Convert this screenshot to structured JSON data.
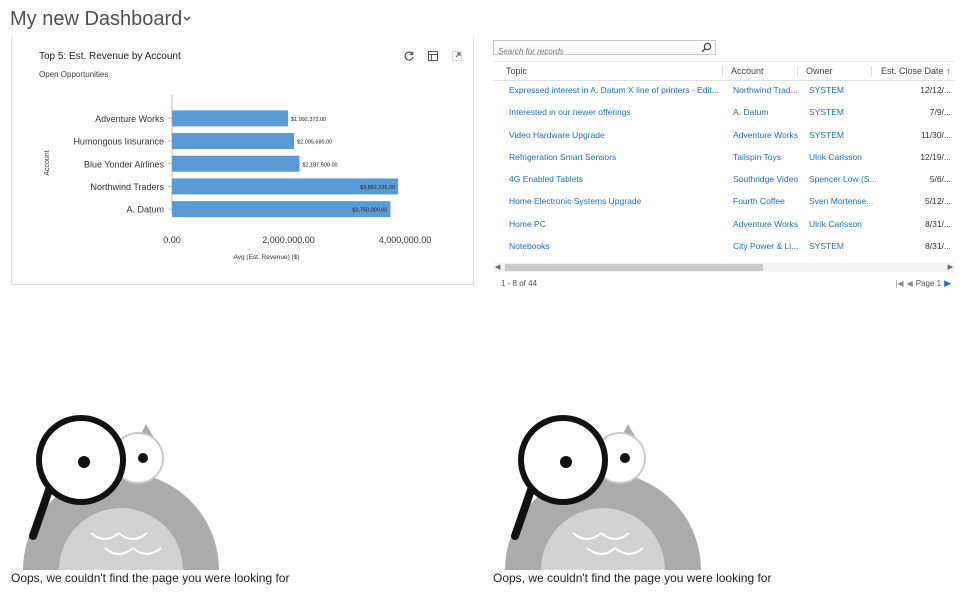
{
  "header": {
    "title": "My new Dashboard"
  },
  "chart_card": {
    "title": "Top 5: Est. Revenue by Account",
    "subtitle": "Open Opportunities",
    "tools": [
      "refresh-icon",
      "view-records-icon",
      "expand-icon"
    ]
  },
  "chart_data": {
    "type": "bar",
    "orientation": "horizontal",
    "categories": [
      "Adventure Works",
      "Humongous Insurance",
      "Blue Yonder Airlines",
      "Northwind Traders",
      "A. Datum"
    ],
    "values": [
      1992372,
      2095680,
      2187500,
      3882225,
      3750000
    ],
    "data_labels": [
      "$1,992,372.00",
      "$2,095,680.00",
      "$2,187,500.00",
      "$3,882,225.00",
      "$3,750,000.00"
    ],
    "xlabel": "Avg (Est. Revenue) ($)",
    "ylabel": "Account",
    "xlim": [
      0,
      4000000
    ],
    "xticks": [
      "0.00",
      "2,000,000.00",
      "4,000,000.00"
    ],
    "bar_color": "#5b9bd5",
    "legend": "none",
    "grid": false
  },
  "grid": {
    "search_placeholder": "Search for records",
    "columns": [
      "Topic",
      "Account",
      "Owner",
      "Est. Close Date"
    ],
    "rows": [
      {
        "topic": "Expressed interest in A. Datum X line of printers - Edit...",
        "account": "Northwind Trad...",
        "owner": "SYSTEM",
        "date": "12/12/..."
      },
      {
        "topic": "Interested in our newer offerings",
        "account": "A. Datum",
        "owner": "SYSTEM",
        "date": "7/9/..."
      },
      {
        "topic": "Video Hardware Upgrade",
        "account": "Adventure Works",
        "owner": "SYSTEM",
        "date": "11/30/..."
      },
      {
        "topic": "Refrigeration Smart Sensors",
        "account": "Tailspin Toys",
        "owner": "Ulrik Carlsson",
        "date": "12/19/..."
      },
      {
        "topic": "4G Enabled Tablets",
        "account": "Southridge Video",
        "owner": "Spencer Low (S...",
        "date": "5/6/..."
      },
      {
        "topic": "Home Electronic Systems Upgrade",
        "account": "Fourth Coffee",
        "owner": "Sven Mortense...",
        "date": "5/12/..."
      },
      {
        "topic": "Home PC",
        "account": "Adventure Works",
        "owner": "Ulrik Carlsson",
        "date": "8/31/..."
      },
      {
        "topic": "Notebooks",
        "account": "City Power & Li...",
        "owner": "SYSTEM",
        "date": "8/31/..."
      }
    ],
    "record_count": "1 - 8 of 44",
    "page_label": "Page 1",
    "link_color": "#1f6fc1"
  },
  "error_panels": [
    {
      "message": "Oops, we couldn't find the page you were looking for"
    },
    {
      "message": "Oops, we couldn't find the page you were looking for"
    }
  ]
}
